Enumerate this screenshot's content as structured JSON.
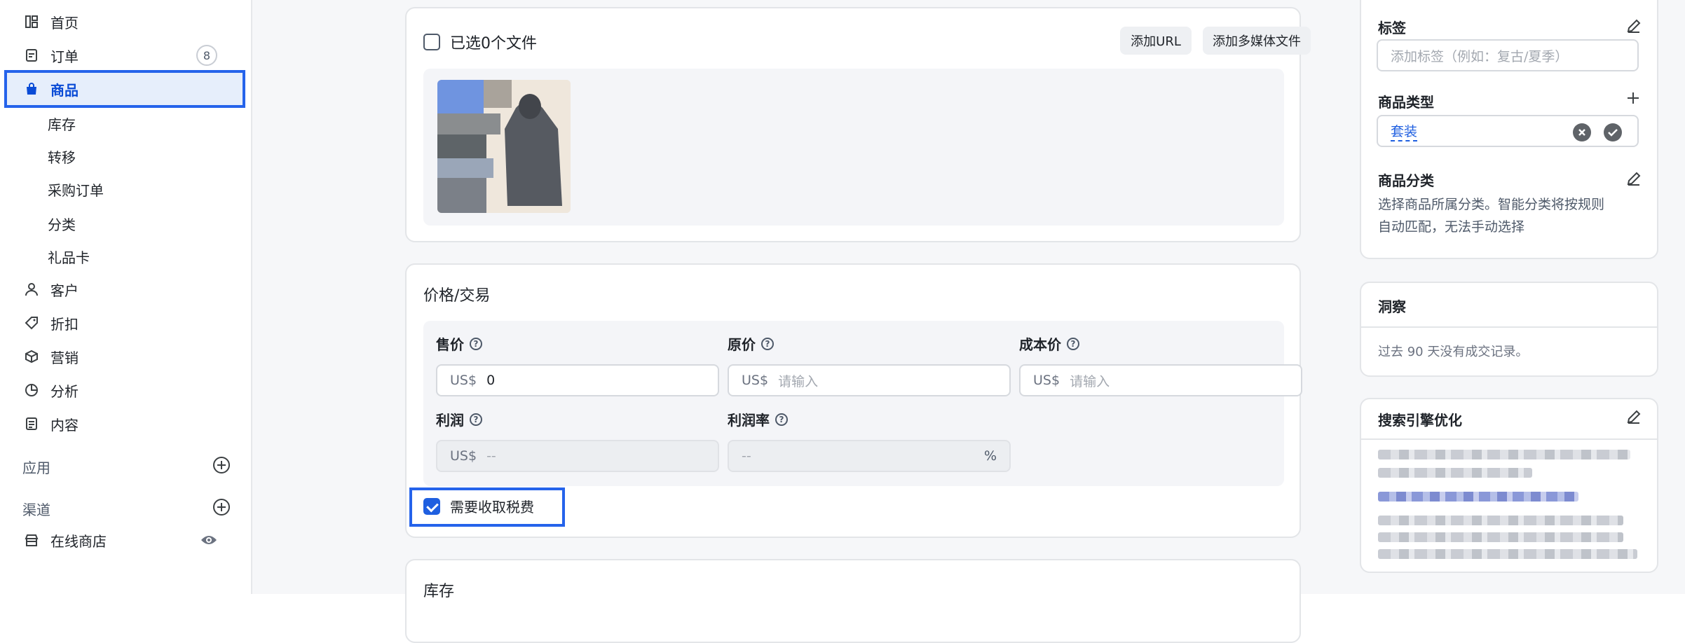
{
  "sidebar": {
    "items": [
      {
        "label": "首页",
        "icon": "dashboard-icon"
      },
      {
        "label": "订单",
        "icon": "order-icon",
        "badge": "8"
      },
      {
        "label": "商品",
        "icon": "bag-icon",
        "active": true
      },
      {
        "label": "客户",
        "icon": "user-icon"
      },
      {
        "label": "折扣",
        "icon": "tag-icon"
      },
      {
        "label": "营销",
        "icon": "box-icon"
      },
      {
        "label": "分析",
        "icon": "pie-icon"
      },
      {
        "label": "内容",
        "icon": "document-icon"
      }
    ],
    "sub_items": [
      "库存",
      "转移",
      "采购订单",
      "分类",
      "礼品卡"
    ],
    "apps_label": "应用",
    "channels_label": "渠道",
    "online_store": "在线商店"
  },
  "media": {
    "selected_label": "已选0个文件",
    "add_url": "添加URL",
    "add_media": "添加多媒体文件"
  },
  "pricing": {
    "title": "价格/交易",
    "price_label": "售价",
    "compare_label": "原价",
    "cost_label": "成本价",
    "profit_label": "利润",
    "margin_label": "利润率",
    "currency": "US$",
    "price_value": "0",
    "placeholder": "请输入",
    "empty": "--",
    "percent": "%",
    "tax_label": "需要收取税费"
  },
  "inventory": {
    "title": "库存"
  },
  "right": {
    "tags_title": "标签",
    "tags_placeholder": "添加标签（例如：复古/夏季）",
    "type_title": "商品类型",
    "type_value": "套装",
    "category_title": "商品分类",
    "category_desc_1": "选择商品所属分类。智能分类将按规则",
    "category_desc_2": "自动匹配，无法手动选择",
    "insights_title": "洞察",
    "insights_text": "过去 90 天没有成交记录。",
    "seo_title": "搜索引擎优化"
  },
  "colors": {
    "accent": "#2563eb",
    "active_bg": "#e6eefb"
  }
}
